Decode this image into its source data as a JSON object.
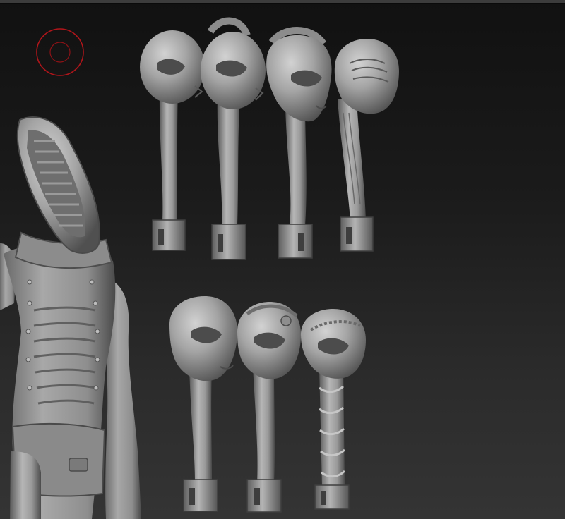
{
  "canvas": {
    "background_top": "#111111",
    "background_bottom": "#343434",
    "clay_color": "#9a9a9a",
    "gizmo_color": "#b0151a"
  },
  "scene": {
    "icons": {
      "navigation_gizmo": "target-circle-icon"
    }
  }
}
